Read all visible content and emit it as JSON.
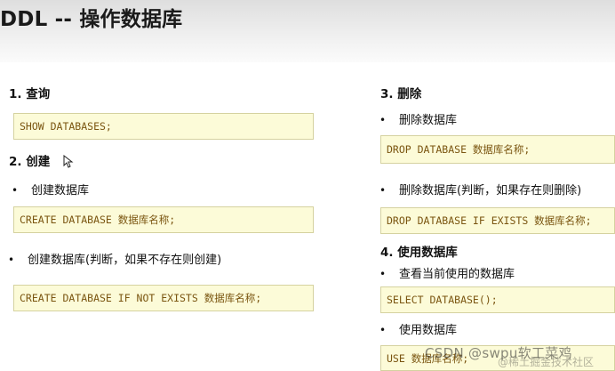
{
  "title": "DDL -- 操作数据库",
  "sections": {
    "query": {
      "heading": "1. 查询",
      "code": "SHOW DATABASES;"
    },
    "create": {
      "heading": "2. 创建",
      "bullet1": "创建数据库",
      "code1": "CREATE DATABASE 数据库名称;",
      "bullet2": "创建数据库(判断，如果不存在则创建)",
      "code2": "CREATE DATABASE IF NOT EXISTS 数据库名称;"
    },
    "delete": {
      "heading": "3. 删除",
      "bullet1": "删除数据库",
      "code1": "DROP DATABASE 数据库名称;",
      "bullet2": "删除数据库(判断，如果存在则删除)",
      "code2": "DROP DATABASE IF EXISTS 数据库名称;"
    },
    "use": {
      "heading": "4. 使用数据库",
      "bullet1": "查看当前使用的数据库",
      "code1": "SELECT DATABASE();",
      "bullet2": "使用数据库",
      "code2": "USE 数据库名称;"
    }
  },
  "bullet_symbol": "•",
  "watermark": "CSDN @swpu软工菜鸡",
  "watermark_sub": "@稀土掘金技术社区",
  "colors": {
    "code_background": "#fcfbd8",
    "code_border": "#d5d2a0",
    "code_text": "#7a5510",
    "header_gradient": "#dedede"
  }
}
